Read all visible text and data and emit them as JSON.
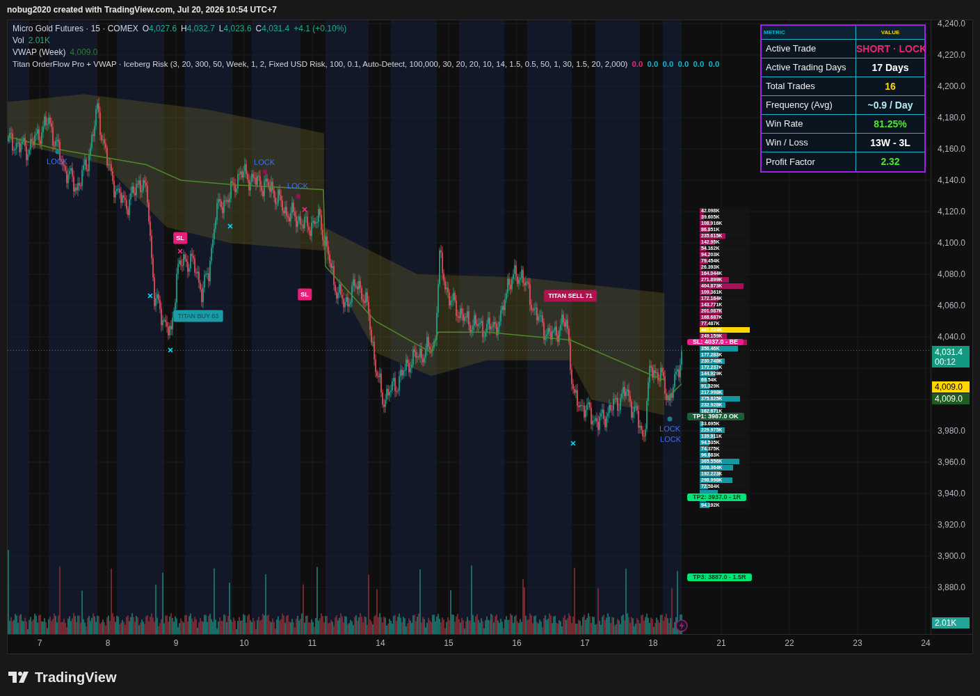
{
  "header": {
    "title": "nobug2020 created with TradingView.com, Jul 20, 2026 10:54 UTC+7"
  },
  "legend": {
    "symbol": "Micro Gold Futures · 15 · COMEX",
    "ohlc": [
      {
        "key": "O",
        "value": "4,027.6"
      },
      {
        "key": "H",
        "value": "4,032.7"
      },
      {
        "key": "L",
        "value": "4,023.6"
      },
      {
        "key": "C",
        "value": "4,031.4"
      }
    ],
    "change": "+4.1 (+0.10%)",
    "volume": {
      "label": "Vol",
      "value": "2.01K"
    },
    "vwap": {
      "label": "VWAP (Week)",
      "value": "4,009.0"
    },
    "indicator": {
      "label": "Titan OrderFlow Pro + VWAP · Iceberg Risk (3, 20, 300, 50, Week, 1, 2, Fixed USD Risk, 100, 0.1, Auto-Detect, 100,000, 30, 20, 20, 10, 14, 1.5, 0.5, 50, 1, 30, 1.5, 20, 2,000)",
      "values": [
        {
          "text": "0.0",
          "color": "#f0266e"
        },
        {
          "text": "0.0",
          "color": "#00bcd4"
        },
        {
          "text": "0.0",
          "color": "#00bcd4"
        },
        {
          "text": "0.0",
          "color": "#00bcd4"
        },
        {
          "text": "0.0",
          "color": "#00bcd4"
        },
        {
          "text": "0.0",
          "color": "#00bcd4"
        }
      ]
    }
  },
  "table": {
    "columns": [
      "METRIC",
      "VALUE"
    ],
    "rows": [
      {
        "metric": "Active Trade",
        "value": "SHORT · LOCK",
        "color": "#f0266e"
      },
      {
        "metric": "Active Trading Days",
        "value": "17 Days",
        "color": "#ffffff"
      },
      {
        "metric": "Total Trades",
        "value": "16",
        "color": "#ffd600"
      },
      {
        "metric": "Frequency (Avg)",
        "value": "~0.9 / Day",
        "color": "#b2ebf2"
      },
      {
        "metric": "Win Rate",
        "value": "81.25%",
        "color": "#4ce62a"
      },
      {
        "metric": "Win / Loss",
        "value": "13W - 3L",
        "color": "#ffffff"
      },
      {
        "metric": "Profit Factor",
        "value": "2.32",
        "color": "#4ce62a"
      }
    ]
  },
  "signals": [
    {
      "kind": "lock",
      "label": "LOCK"
    },
    {
      "kind": "lock",
      "label": "LOCK"
    },
    {
      "kind": "lock",
      "label": "LOCK"
    },
    {
      "kind": "lock",
      "label": "LOCK"
    },
    {
      "kind": "lock",
      "label": "LOCK"
    },
    {
      "kind": "sl",
      "label": "SL"
    },
    {
      "kind": "sl",
      "label": "SL"
    },
    {
      "kind": "buy",
      "label": "TITAN BUY 63"
    },
    {
      "kind": "sell",
      "label": "TITAN SELL 71"
    }
  ],
  "profile": [
    {
      "kind": "sell",
      "label": "42.098K",
      "level": 0.09
    },
    {
      "kind": "sell",
      "label": "39.605K",
      "level": 0.09
    },
    {
      "kind": "sell",
      "label": "108.916K",
      "level": 0.24
    },
    {
      "kind": "sell",
      "label": "86.851K",
      "level": 0.19
    },
    {
      "kind": "sell",
      "label": "235.615K",
      "level": 0.51
    },
    {
      "kind": "sell",
      "label": "142.95K",
      "level": 0.31
    },
    {
      "kind": "sell",
      "label": "54.162K",
      "level": 0.12
    },
    {
      "kind": "sell",
      "label": "94.203K",
      "level": 0.2
    },
    {
      "kind": "sell",
      "label": "79.454K",
      "level": 0.17
    },
    {
      "kind": "sell",
      "label": "26.393K",
      "level": 0.06
    },
    {
      "kind": "sell",
      "label": "164.044K",
      "level": 0.36
    },
    {
      "kind": "sell",
      "label": "271.899K",
      "level": 0.59
    },
    {
      "kind": "sell",
      "label": "404.873K",
      "level": 0.88
    },
    {
      "kind": "sell",
      "label": "109.361K",
      "level": 0.24
    },
    {
      "kind": "sell",
      "label": "172.164K",
      "level": 0.37
    },
    {
      "kind": "sell",
      "label": "143.771K",
      "level": 0.31
    },
    {
      "kind": "sell",
      "label": "201.087K",
      "level": 0.44
    },
    {
      "kind": "sell",
      "label": "168.687K",
      "level": 0.37
    },
    {
      "kind": "sell",
      "label": "77.487K",
      "level": 0.17
    },
    {
      "kind": "poc",
      "label": "461.224K",
      "level": 1
    },
    {
      "kind": "sell",
      "label": "249.159K",
      "level": 0.54
    },
    {
      "kind": "sell",
      "level": 0.95
    },
    {
      "kind": "buy",
      "label": "356.46K",
      "level": 0.77
    },
    {
      "kind": "buy",
      "label": "177.283K",
      "level": 0.38
    },
    {
      "kind": "buy",
      "label": "230.748K",
      "level": 0.5
    },
    {
      "kind": "buy",
      "label": "172.237K",
      "level": 0.37
    },
    {
      "kind": "buy",
      "label": "144.929K",
      "level": 0.31
    },
    {
      "kind": "buy",
      "label": "69.54K",
      "level": 0.15
    },
    {
      "kind": "buy",
      "label": "91.329K",
      "level": 0.2
    },
    {
      "kind": "buy",
      "label": "217.998K",
      "level": 0.47
    },
    {
      "kind": "buy",
      "label": "375.825K",
      "level": 0.81
    },
    {
      "kind": "buy",
      "label": "232.928K",
      "level": 0.51
    },
    {
      "kind": "buy",
      "label": "162.671K",
      "level": 0.35
    },
    {
      "kind": "buy",
      "level": 0.1
    },
    {
      "kind": "buy",
      "label": "33.695K",
      "level": 0.07
    },
    {
      "kind": "buy",
      "label": "229.975K",
      "level": 0.5
    },
    {
      "kind": "buy",
      "label": "139.911K",
      "level": 0.3
    },
    {
      "kind": "buy",
      "label": "94.535K",
      "level": 0.2
    },
    {
      "kind": "buy",
      "label": "74.375K",
      "level": 0.16
    },
    {
      "kind": "buy",
      "label": "96.683K",
      "level": 0.21
    },
    {
      "kind": "buy",
      "label": "365.556K",
      "level": 0.79
    },
    {
      "kind": "buy",
      "label": "308.364K",
      "level": 0.67
    },
    {
      "kind": "buy",
      "label": "192.223K",
      "level": 0.42
    },
    {
      "kind": "buy",
      "label": "298.998K",
      "level": 0.65
    },
    {
      "kind": "buy",
      "label": "72.584K",
      "level": 0.16
    },
    {
      "kind": "buy",
      "level": 0.36
    },
    {
      "kind": "buy",
      "level": 0.12
    },
    {
      "kind": "buy",
      "label": "94.192K",
      "level": 0.2
    }
  ],
  "trade_levels": [
    {
      "kind": "sl",
      "label": "SL: 4037.0 - BE"
    },
    {
      "kind": "tp_hit",
      "label": "TP1: 3987.0 OK"
    },
    {
      "kind": "tp",
      "label": "TP2: 3937.0 - 1R"
    },
    {
      "kind": "tp",
      "label": "TP3: 3887.0 - 1.5R"
    }
  ],
  "price_axis": {
    "upper_ticks": [
      "4,240.0",
      "4,220.0",
      "4,200.0",
      "4,180.0",
      "4,160.0",
      "4,140.0",
      "4,120.0",
      "4,100.0",
      "4,080.0",
      "4,060.0",
      "4,040.0"
    ],
    "lower_ticks": [
      "3,980.0",
      "3,960.0",
      "3,940.0",
      "3,920.0",
      "3,900.0",
      "3,880.0"
    ],
    "last_price": {
      "value": "4,031.4",
      "countdown": "00:12"
    },
    "markers": [
      {
        "kind": "indicator",
        "text": "4,009.0"
      },
      {
        "kind": "vwap",
        "text": "4,009.0"
      },
      {
        "kind": "volume",
        "text": "2.01K"
      }
    ]
  },
  "time_axis": [
    "7",
    "8",
    "9",
    "10",
    "11",
    "14",
    "15",
    "16",
    "17",
    "18",
    "21",
    "22",
    "23",
    "24"
  ],
  "footer": {
    "brand": "TradingView"
  }
}
